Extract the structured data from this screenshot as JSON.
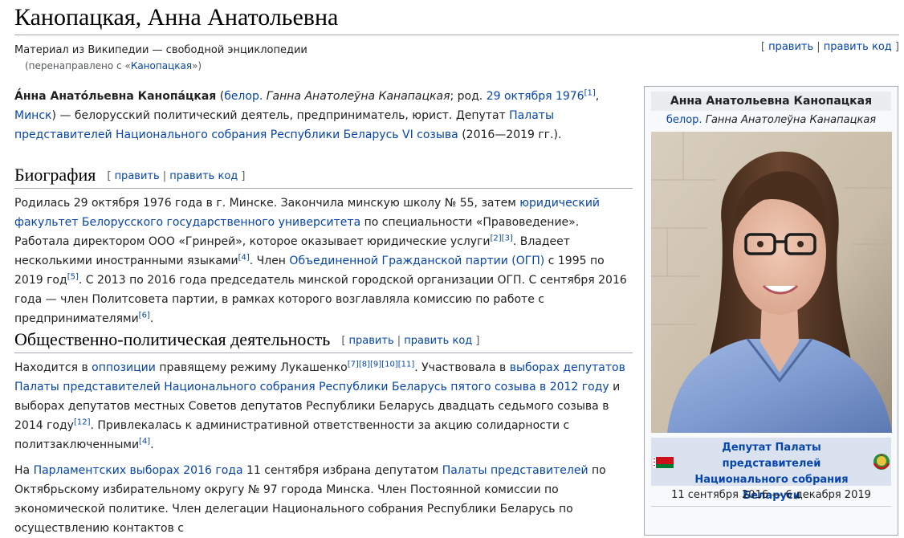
{
  "page": {
    "title": "Канопацкая, Анна Анатольевна",
    "site_sub": "Материал из Википедии — свободной энциклопедии",
    "redirect_prefix": "(перенаправлено с «",
    "redirect_link": "Канопацкая",
    "redirect_suffix": "»)",
    "edit": "править",
    "edit_code": "править код"
  },
  "intro": {
    "name": "А́нна Анато́льевна Канопа́цкая",
    "open_paren": " (",
    "lang": "белор.",
    "native": " Ганна Анатолеўна Канапацкая",
    "born": "; род. ",
    "birth_date": "29 октября 1976",
    "ref1": "[1]",
    "comma": ",",
    "city": "Минск",
    "rest1": ") — белорусский политический деятель, предприниматель, юрист. Депутат ",
    "parliament_link": "Палаты представителей Национального собрания Республики Беларусь VI созыва",
    "rest2": " (2016—2019 гг.)."
  },
  "bio": {
    "heading": "Биография",
    "t1": "Родилась 29 октября 1976 года в г. Минске. Закончила минскую школу № 55, затем ",
    "link1": "юридический факультет Белорусского государственного университета",
    "t2": " по специальности «Правоведение». Работала директором ООО «Гринрей», которое оказывает юридические услуги",
    "ref23": "[2][3]",
    "t3": ". Владеет несколькими иностранными языками",
    "ref4": "[4]",
    "t4": ". Член ",
    "link2": "Объединенной Гражданской партии (ОГП)",
    "t5": " с 1995 по 2019 год",
    "ref5": "[5]",
    "t6": ". С 2013 по 2016 года председатель минской городской организации ОГП. С сентября 2016 года — член Политсовета партии, в рамках которого возглавляла комиссию по работе с предпринимателями",
    "ref6": "[6]",
    "t7": "."
  },
  "politics": {
    "heading": "Общественно-политическая деятельность",
    "p1_t1": "Находится в ",
    "p1_link1": "оппозиции",
    "p1_t2": " правящему режиму Лукашенко",
    "p1_refs": "[7][8][9][10][11]",
    "p1_t3": ". Участвовала в ",
    "p1_link2": "выборах депутатов Палаты представителей Национального собрания Республики Беларусь пятого созыва в 2012 году",
    "p1_t4": " и выборах депутатов местных Советов депутатов Республики Беларусь двадцать седьмого созыва в 2014 году",
    "p1_ref12": "[12]",
    "p1_t5": ". Привлекалась к административной ответственности за акцию солидарности с политзаключенными",
    "p1_ref4": "[4]",
    "p1_t6": ".",
    "p2_t1": "На ",
    "p2_link1": "Парламентских выборах 2016 года",
    "p2_t2": " 11 сентября избрана депутатом ",
    "p2_link2": "Палаты представителей",
    "p2_t3": " по Октябрьскому избирательному округу № 97 города Минска. Член Постоянной комиссии по экономической политике. Член делегации Национального собрания Республики Беларусь по осуществлению контактов с"
  },
  "infobox": {
    "name": "Анна Анатольевна Канопацкая",
    "lang": "белор.",
    "native": " Ганна Анатолеўна Канапацкая",
    "office": "Депутат Палаты представителей Национального собрания Беларуси",
    "dates": "11 сентября 2016 — 6 декабря 2019"
  },
  "colors": {
    "link": "#0645ad",
    "rule": "#a2a9b1",
    "infobox_bg": "#f8f9fa",
    "office_bg": "#dae1ef"
  }
}
